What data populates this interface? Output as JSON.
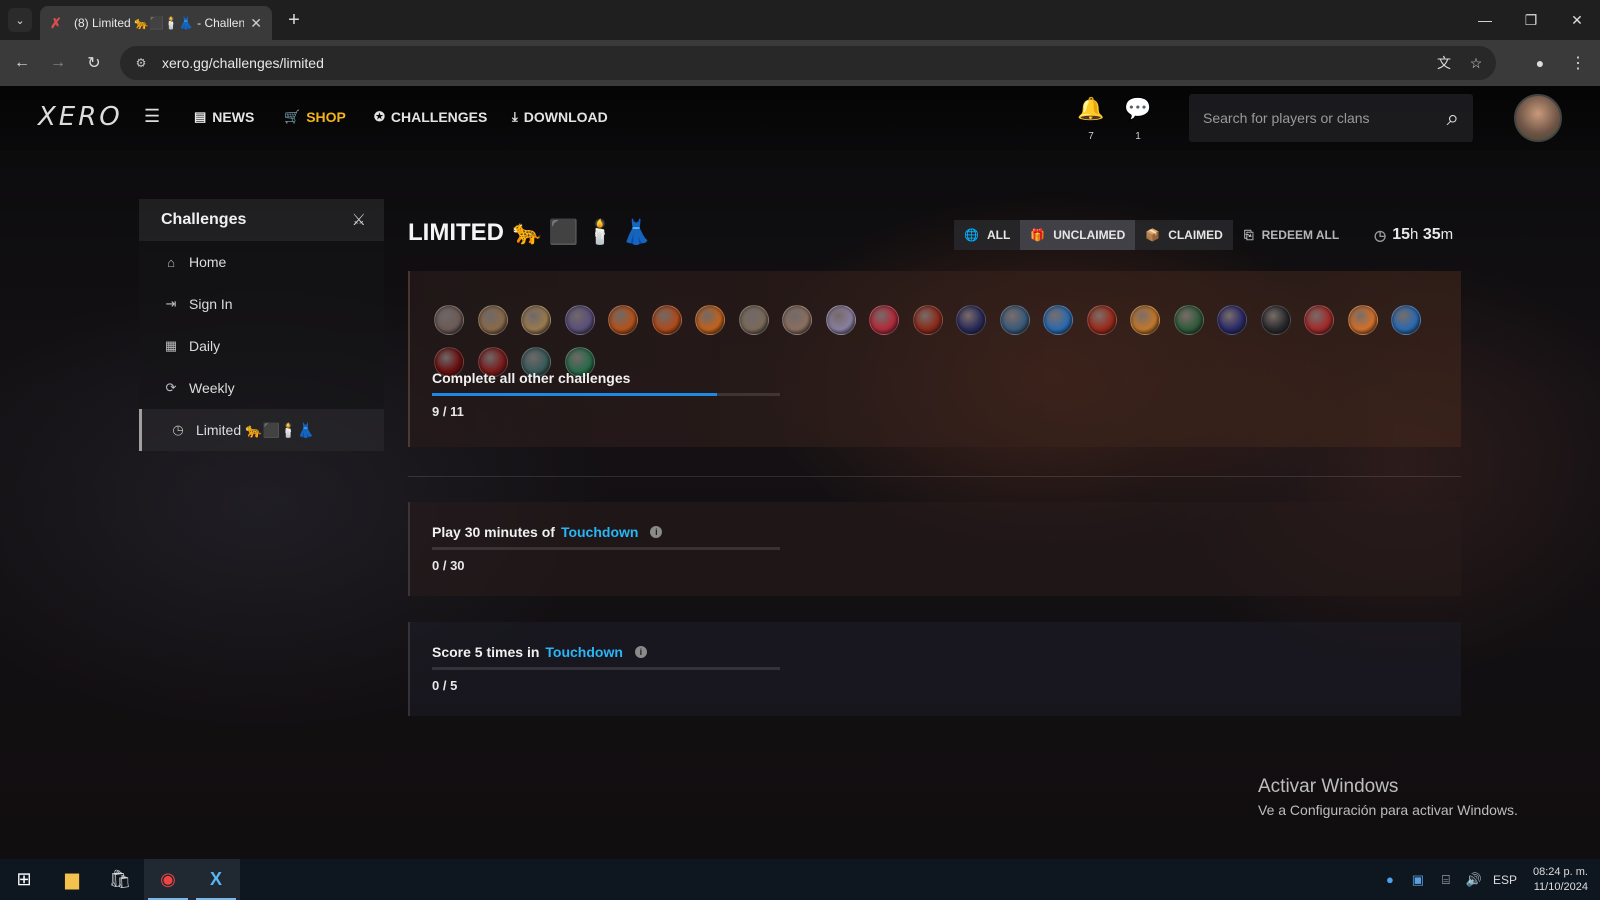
{
  "browser": {
    "tab_title": "(8) Limited 🐆⬛🕯️👗 - Challenge",
    "url": "xero.gg/challenges/limited"
  },
  "site": {
    "logo": "XERO",
    "nav": {
      "news": "NEWS",
      "shop": "SHOP",
      "challenges": "CHALLENGES",
      "download": "DOWNLOAD"
    },
    "notifications_count": "7",
    "messages_count": "1",
    "search_placeholder": "Search for players or clans"
  },
  "sidebar": {
    "title": "Challenges",
    "items": [
      {
        "label": "Home",
        "icon": "home-icon"
      },
      {
        "label": "Sign In",
        "icon": "sign-in-icon"
      },
      {
        "label": "Daily",
        "icon": "calendar-icon"
      },
      {
        "label": "Weekly",
        "icon": "refresh-icon"
      },
      {
        "label": "Limited 🐆⬛🕯️👗",
        "icon": "clock-icon",
        "active": true
      }
    ]
  },
  "main": {
    "title": "LIMITED",
    "title_emojis": "🐆 ⬛ 🕯️ 👗",
    "filters": {
      "all": "ALL",
      "unclaimed": "UNCLAIMED",
      "claimed": "CLAIMED"
    },
    "redeem_all": "REDEEM ALL",
    "timer": {
      "hours": "15",
      "h": "h",
      "minutes": "35",
      "m": "m"
    },
    "challenges": [
      {
        "title": "Complete all other challenges",
        "mode": "",
        "progress_text": "9 / 11",
        "progress": 0.818
      },
      {
        "title": "Play 30 minutes of",
        "mode": "Touchdown",
        "progress_text": "0 / 30",
        "progress": 0
      },
      {
        "title": "Score 5 times in",
        "mode": "Touchdown",
        "progress_text": "0 / 5",
        "progress": 0
      }
    ],
    "badge_colors": [
      "#6b5a55",
      "#8a6a4a",
      "#9a7a50",
      "#5a4f7a",
      "#b5521b",
      "#b04a1a",
      "#c2621c",
      "#7a6a5a",
      "#8a6f60",
      "#8a7fa0",
      "#b22a3a",
      "#8a2a1a",
      "#2a2a5a",
      "#3a5a7a",
      "#2a6ab0",
      "#9a2a1a",
      "#c2782a",
      "#2f5a3a",
      "#2a2a6a",
      "#2a2a2e",
      "#a02a2a",
      "#d2702a",
      "#2a6ab0",
      "#6a1010",
      "#7a1a1a",
      "#3a5a5a",
      "#2a6a4a"
    ]
  },
  "os": {
    "activate_title": "Activar Windows",
    "activate_sub": "Ve a Configuración para activar Windows.",
    "lang": "ESP",
    "time": "08:24 p. m.",
    "date": "11/10/2024"
  }
}
